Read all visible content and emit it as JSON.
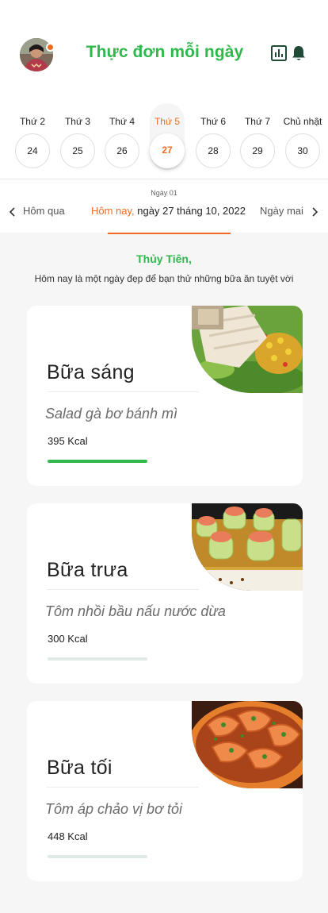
{
  "header": {
    "title": "Thực đơn mỗi ngày",
    "title_color": "#2fb84b",
    "avatar_icon": "user-avatar",
    "avatar_badge_color": "#ef6c22",
    "stats_icon": "bar-chart-icon",
    "notifications_icon": "bell-icon"
  },
  "week": {
    "days": [
      {
        "label": "Thứ 2",
        "date": "24",
        "active": false
      },
      {
        "label": "Thứ 3",
        "date": "25",
        "active": false
      },
      {
        "label": "Thứ 4",
        "date": "26",
        "active": false
      },
      {
        "label": "Thứ 5",
        "date": "27",
        "active": true
      },
      {
        "label": "Thứ 6",
        "date": "28",
        "active": false
      },
      {
        "label": "Thứ 7",
        "date": "29",
        "active": false
      },
      {
        "label": "Chủ nhật",
        "date": "30",
        "active": false
      }
    ],
    "active_color": "#ef6c22"
  },
  "date_nav": {
    "day_index": "Ngày 01",
    "prev": "Hôm qua",
    "today_word": "Hôm nay,",
    "today_date": "ngày 27 tháng 10, 2022",
    "next": "Ngày mai"
  },
  "greeting": {
    "name": "Thủy Tiên,",
    "message": "Hôm nay là một ngày đẹp để bạn thử những bữa ăn tuyệt vời"
  },
  "meals": [
    {
      "title": "Bữa sáng",
      "dish": "Salad gà bơ bánh mì",
      "kcal": "395 Kcal",
      "progress": 1.0,
      "image": "chicken-salad-photo"
    },
    {
      "title": "Bữa trưa",
      "dish": "Tôm nhồi bầu nấu nước dừa",
      "kcal": "300 Kcal",
      "progress": 0.0,
      "image": "stuffed-gourd-shrimp-photo"
    },
    {
      "title": "Bữa tối",
      "dish": "Tôm áp chảo vị bơ tỏi",
      "kcal": "448 Kcal",
      "progress": 0.0,
      "image": "garlic-butter-shrimp-photo"
    }
  ],
  "colors": {
    "accent_green": "#2fb84b",
    "accent_orange": "#ef6c22",
    "progress_track": "#dfeae4"
  }
}
